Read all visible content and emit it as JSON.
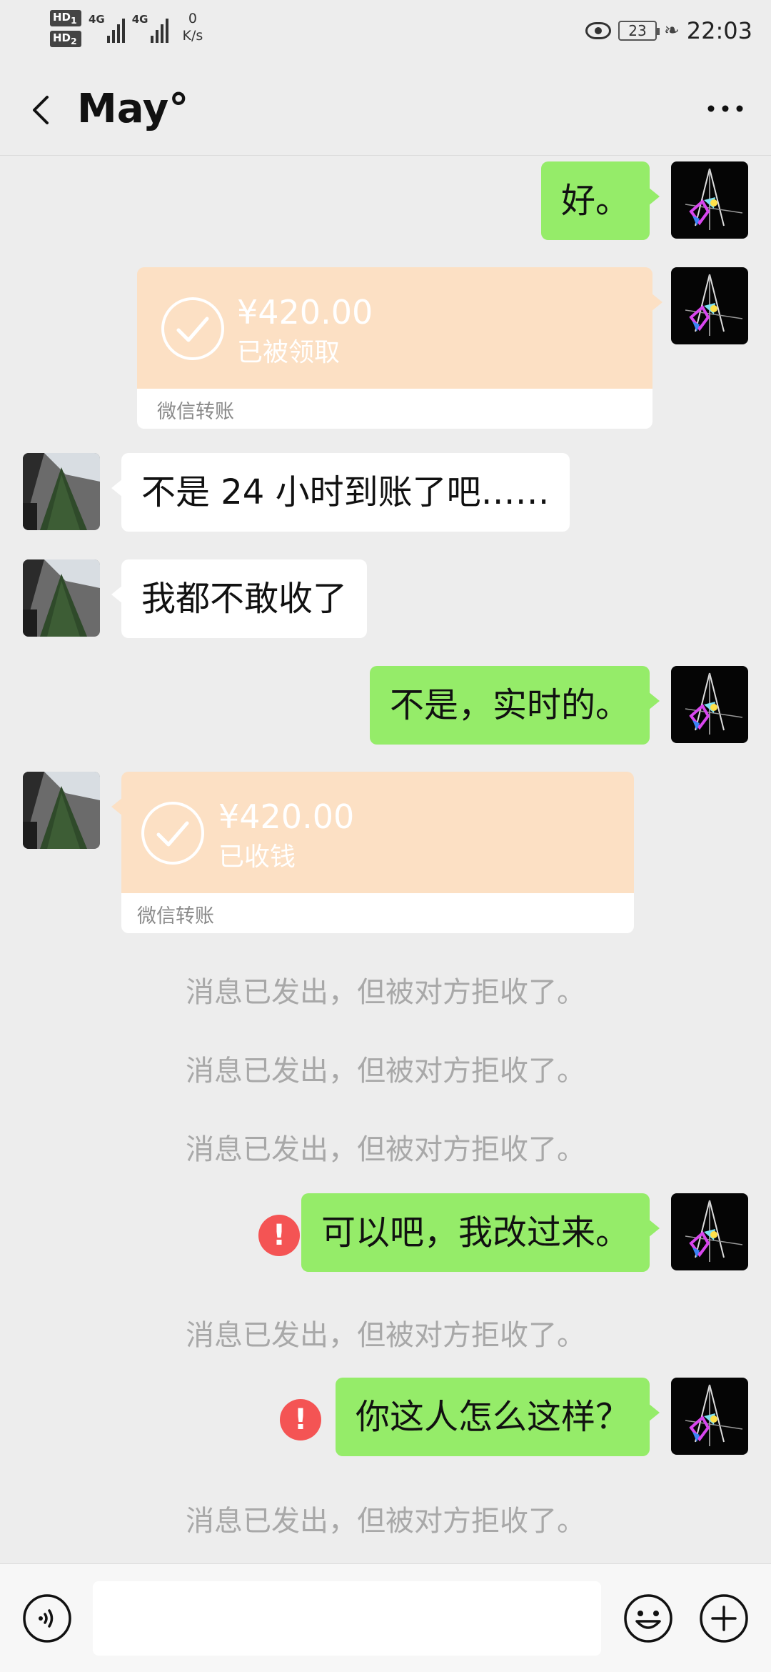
{
  "status_bar": {
    "hd1": "HD",
    "hd1_sub": "1",
    "hd2": "HD",
    "hd2_sub": "2",
    "net_type_1": "4G",
    "net_type_2": "4G",
    "speed_value": "0",
    "speed_unit": "K/s",
    "battery": "23",
    "time": "22:03",
    "icons": [
      "eye-icon",
      "battery-icon",
      "leaf-icon"
    ]
  },
  "header": {
    "title": "May°",
    "back_icon": "chevron-left",
    "more_icon": "more-dots"
  },
  "messages": [
    {
      "type": "text",
      "side": "out",
      "text": "好。"
    },
    {
      "type": "transfer",
      "side": "out",
      "amount": "¥420.00",
      "status": "已被领取",
      "footer": "微信转账"
    },
    {
      "type": "text",
      "side": "in",
      "text": "不是 24 小时到账了吧……"
    },
    {
      "type": "text",
      "side": "in",
      "text": "我都不敢收了"
    },
    {
      "type": "text",
      "side": "out",
      "text": "不是，实时的。"
    },
    {
      "type": "transfer",
      "side": "in",
      "amount": "¥420.00",
      "status": "已收钱",
      "footer": "微信转账"
    },
    {
      "type": "system",
      "text": "消息已发出，但被对方拒收了。"
    },
    {
      "type": "system",
      "text": "消息已发出，但被对方拒收了。"
    },
    {
      "type": "system",
      "text": "消息已发出，但被对方拒收了。"
    },
    {
      "type": "text",
      "side": "out",
      "text": "可以吧，我改过来。",
      "error": "!"
    },
    {
      "type": "system",
      "text": "消息已发出，但被对方拒收了。"
    },
    {
      "type": "text",
      "side": "out",
      "text": "你这人怎么这样？",
      "error": "!"
    },
    {
      "type": "system",
      "text": "消息已发出，但被对方拒收了。"
    }
  ],
  "input_bar": {
    "value": "",
    "icons": [
      "voice-icon",
      "emoji-icon",
      "plus-icon"
    ]
  },
  "colors": {
    "background": "#ededed",
    "outgoing_bubble": "#95ec69",
    "incoming_bubble": "#ffffff",
    "transfer_card": "#fce0c4",
    "error": "#f45454",
    "system_text": "#a8a8a8"
  }
}
